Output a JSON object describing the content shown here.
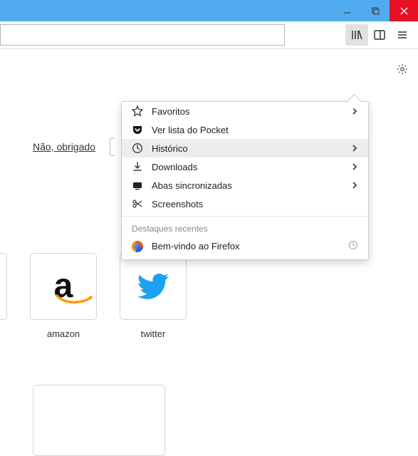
{
  "window": {
    "minimize": "_",
    "maximize": "❐",
    "close": "×"
  },
  "menu": {
    "items": [
      {
        "label": "Favoritos",
        "icon": "star",
        "chev": true
      },
      {
        "label": "Ver lista do Pocket",
        "icon": "pocket"
      },
      {
        "label": "Histórico",
        "icon": "clock",
        "chev": true,
        "hover": true
      },
      {
        "label": "Downloads",
        "icon": "download",
        "chev": true
      },
      {
        "label": "Abas sincronizadas",
        "icon": "synced",
        "chev": true
      },
      {
        "label": "Screenshots",
        "icon": "scissors"
      }
    ],
    "recent_heading": "Destaques recentes",
    "recent_item": "Bem-vindo ao Firefox"
  },
  "dismiss": {
    "label": "Não, obrigado"
  },
  "tiles": [
    {
      "label": "amazon",
      "kind": "amazon"
    },
    {
      "label": "twitter",
      "kind": "twitter"
    }
  ]
}
